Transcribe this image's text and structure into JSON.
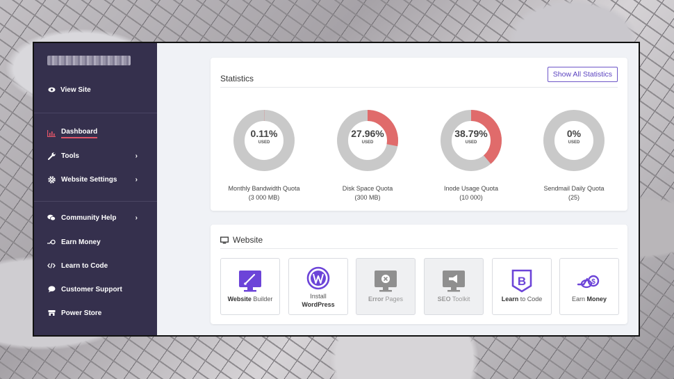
{
  "sidebar": {
    "view_site": "View Site",
    "items": [
      {
        "label": "Dashboard",
        "icon": "chart-icon"
      },
      {
        "label": "Tools",
        "icon": "wrench-icon"
      },
      {
        "label": "Website Settings",
        "icon": "gear-icon"
      },
      {
        "label": "Community Help",
        "icon": "chat-icon"
      },
      {
        "label": "Earn Money",
        "icon": "money-icon"
      },
      {
        "label": "Learn to Code",
        "icon": "code-icon"
      },
      {
        "label": "Customer Support",
        "icon": "bubble-icon"
      },
      {
        "label": "Power Store",
        "icon": "store-icon"
      }
    ]
  },
  "statistics": {
    "title": "Statistics",
    "show_all": "Show All Statistics",
    "used_label": "USED",
    "gauges": [
      {
        "percent": "0.11%",
        "value": 0.11,
        "label": "Monthly Bandwidth Quota",
        "sub": "(3 000 MB)"
      },
      {
        "percent": "27.96%",
        "value": 27.96,
        "label": "Disk Space Quota",
        "sub": "(300 MB)"
      },
      {
        "percent": "38.79%",
        "value": 38.79,
        "label": "Inode Usage Quota",
        "sub": "(10 000)"
      },
      {
        "percent": "0%",
        "value": 0,
        "label": "Sendmail Daily Quota",
        "sub": "(25)"
      }
    ]
  },
  "website": {
    "title": "Website",
    "tiles": [
      {
        "bold": "Website",
        "rest": " Builder",
        "line2": ""
      },
      {
        "bold": "",
        "rest": "Install",
        "line2": "WordPress"
      },
      {
        "bold": "Error",
        "rest": " Pages",
        "line2": ""
      },
      {
        "bold": "SEO",
        "rest": " Toolkit",
        "line2": ""
      },
      {
        "bold": "Learn",
        "rest": " to Code",
        "line2": ""
      },
      {
        "bold": "",
        "rest": "Earn ",
        "line2": "Money"
      }
    ]
  },
  "colors": {
    "sidebar_bg": "#35304d",
    "accent": "#6c55c8",
    "gauge_used": "#e06b6b",
    "gauge_track": "#c9c9c9"
  }
}
